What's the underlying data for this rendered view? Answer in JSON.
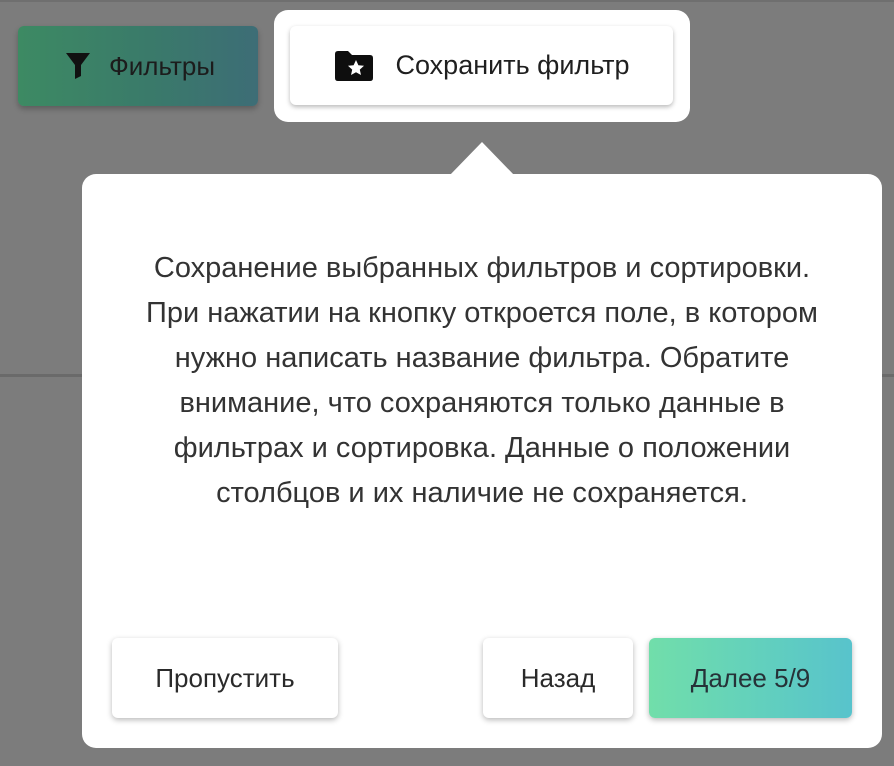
{
  "toolbar": {
    "filters_label": "Фильтры",
    "save_filter_label": "Сохранить фильтр"
  },
  "icons": {
    "filters": "funnel-icon",
    "save_filter": "folder-star-icon"
  },
  "tour": {
    "description": "Сохранение выбранных фильтров и сортировки. При нажатии на кнопку откроется поле, в котором нужно написать название фильтра. Обратите внимание, что сохраняются только данные в фильтрах и сортировка. Данные о положении столбцов и их наличие не сохраняется.",
    "skip_label": "Пропустить",
    "back_label": "Назад",
    "next_label": "Далее 5/9",
    "step_current": 5,
    "step_total": 9
  },
  "colors": {
    "overlay": "#7c7c7c",
    "filters_button": "#3d8a63",
    "next_gradient_start": "#71deaa",
    "next_gradient_end": "#58c3cc",
    "tooltip_bg": "#ffffff"
  }
}
